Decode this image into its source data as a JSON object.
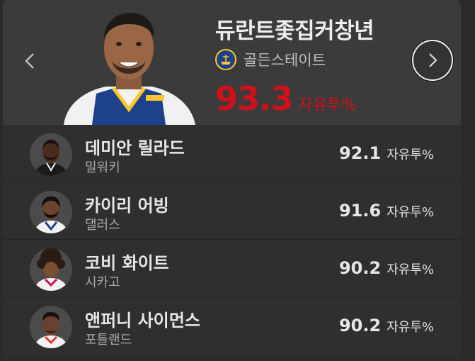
{
  "featured": {
    "name": "듀란트좇집커창년",
    "team": "골든스테이트",
    "team_logo_icon": "warriors-logo-icon",
    "value": "93.3",
    "unit": "자유투%",
    "accent_color": "#d0101b"
  },
  "navigation": {
    "prev_icon": "chevron-left-icon",
    "next_icon": "chevron-right-icon"
  },
  "players": [
    {
      "name": "데미안 릴라드",
      "team": "밀워키",
      "value": "92.1",
      "unit": "자유투%"
    },
    {
      "name": "카이리 어빙",
      "team": "댈러스",
      "value": "91.6",
      "unit": "자유투%"
    },
    {
      "name": "코비 화이트",
      "team": "시카고",
      "value": "90.2",
      "unit": "자유투%"
    },
    {
      "name": "앤퍼니 사이먼스",
      "team": "포틀랜드",
      "value": "90.2",
      "unit": "자유투%"
    }
  ]
}
